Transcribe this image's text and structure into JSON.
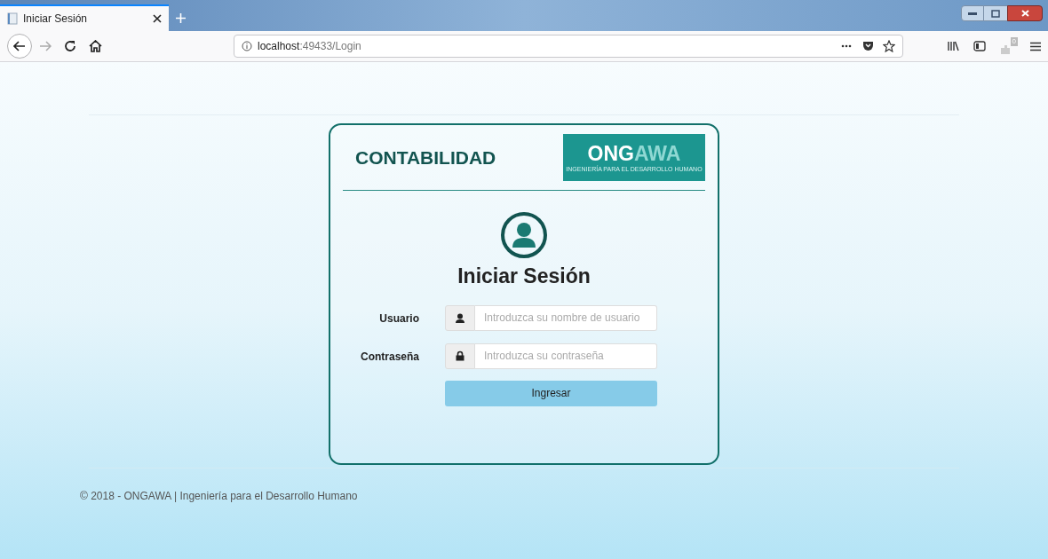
{
  "browser": {
    "tabs": [
      {
        "title": "Iniciar Sesión",
        "selected": true
      }
    ],
    "address": {
      "host": "localhost",
      "path": ":49433/Login"
    },
    "pocket_badge": "0"
  },
  "login": {
    "app_title": "CONTABILIDAD",
    "logo": {
      "name": "ONG",
      "name_accent": "AWA",
      "tagline": "INGENIERÍA PARA EL DESARROLLO HUMANO"
    },
    "heading": "Iniciar Sesión",
    "fields": [
      {
        "kind": "user",
        "label": "Usuario",
        "placeholder": "Introduzca su nombre de usuario"
      },
      {
        "kind": "password",
        "label": "Contraseña",
        "placeholder": "Introduzca su contraseña"
      }
    ],
    "submit": "Ingresar"
  },
  "footer": "© 2018 - ONGAWA | Ingeniería para el Desarrollo Humano"
}
